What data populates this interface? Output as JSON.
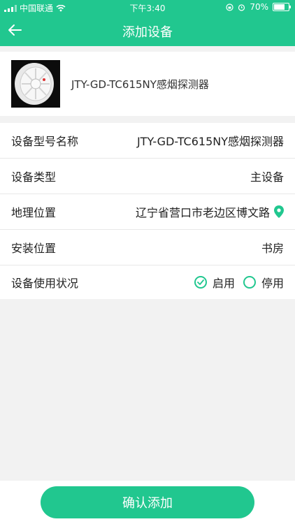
{
  "status_bar": {
    "carrier": "中国联通",
    "time": "下午3:40",
    "battery": "70%"
  },
  "header": {
    "title": "添加设备"
  },
  "product": {
    "name": "JTY-GD-TC615NY感烟探测器"
  },
  "rows": [
    {
      "label": "设备型号名称",
      "value": "JTY-GD-TC615NY感烟探测器"
    },
    {
      "label": "设备类型",
      "value": "主设备"
    },
    {
      "label": "地理位置",
      "value": "辽宁省营口市老边区博文路"
    },
    {
      "label": "安装位置",
      "value": "书房"
    }
  ],
  "status_row": {
    "label": "设备使用状况",
    "options": [
      "启用",
      "停用"
    ],
    "selected": "启用"
  },
  "footer": {
    "confirm_label": "确认添加"
  },
  "colors": {
    "accent": "#21c78f"
  }
}
